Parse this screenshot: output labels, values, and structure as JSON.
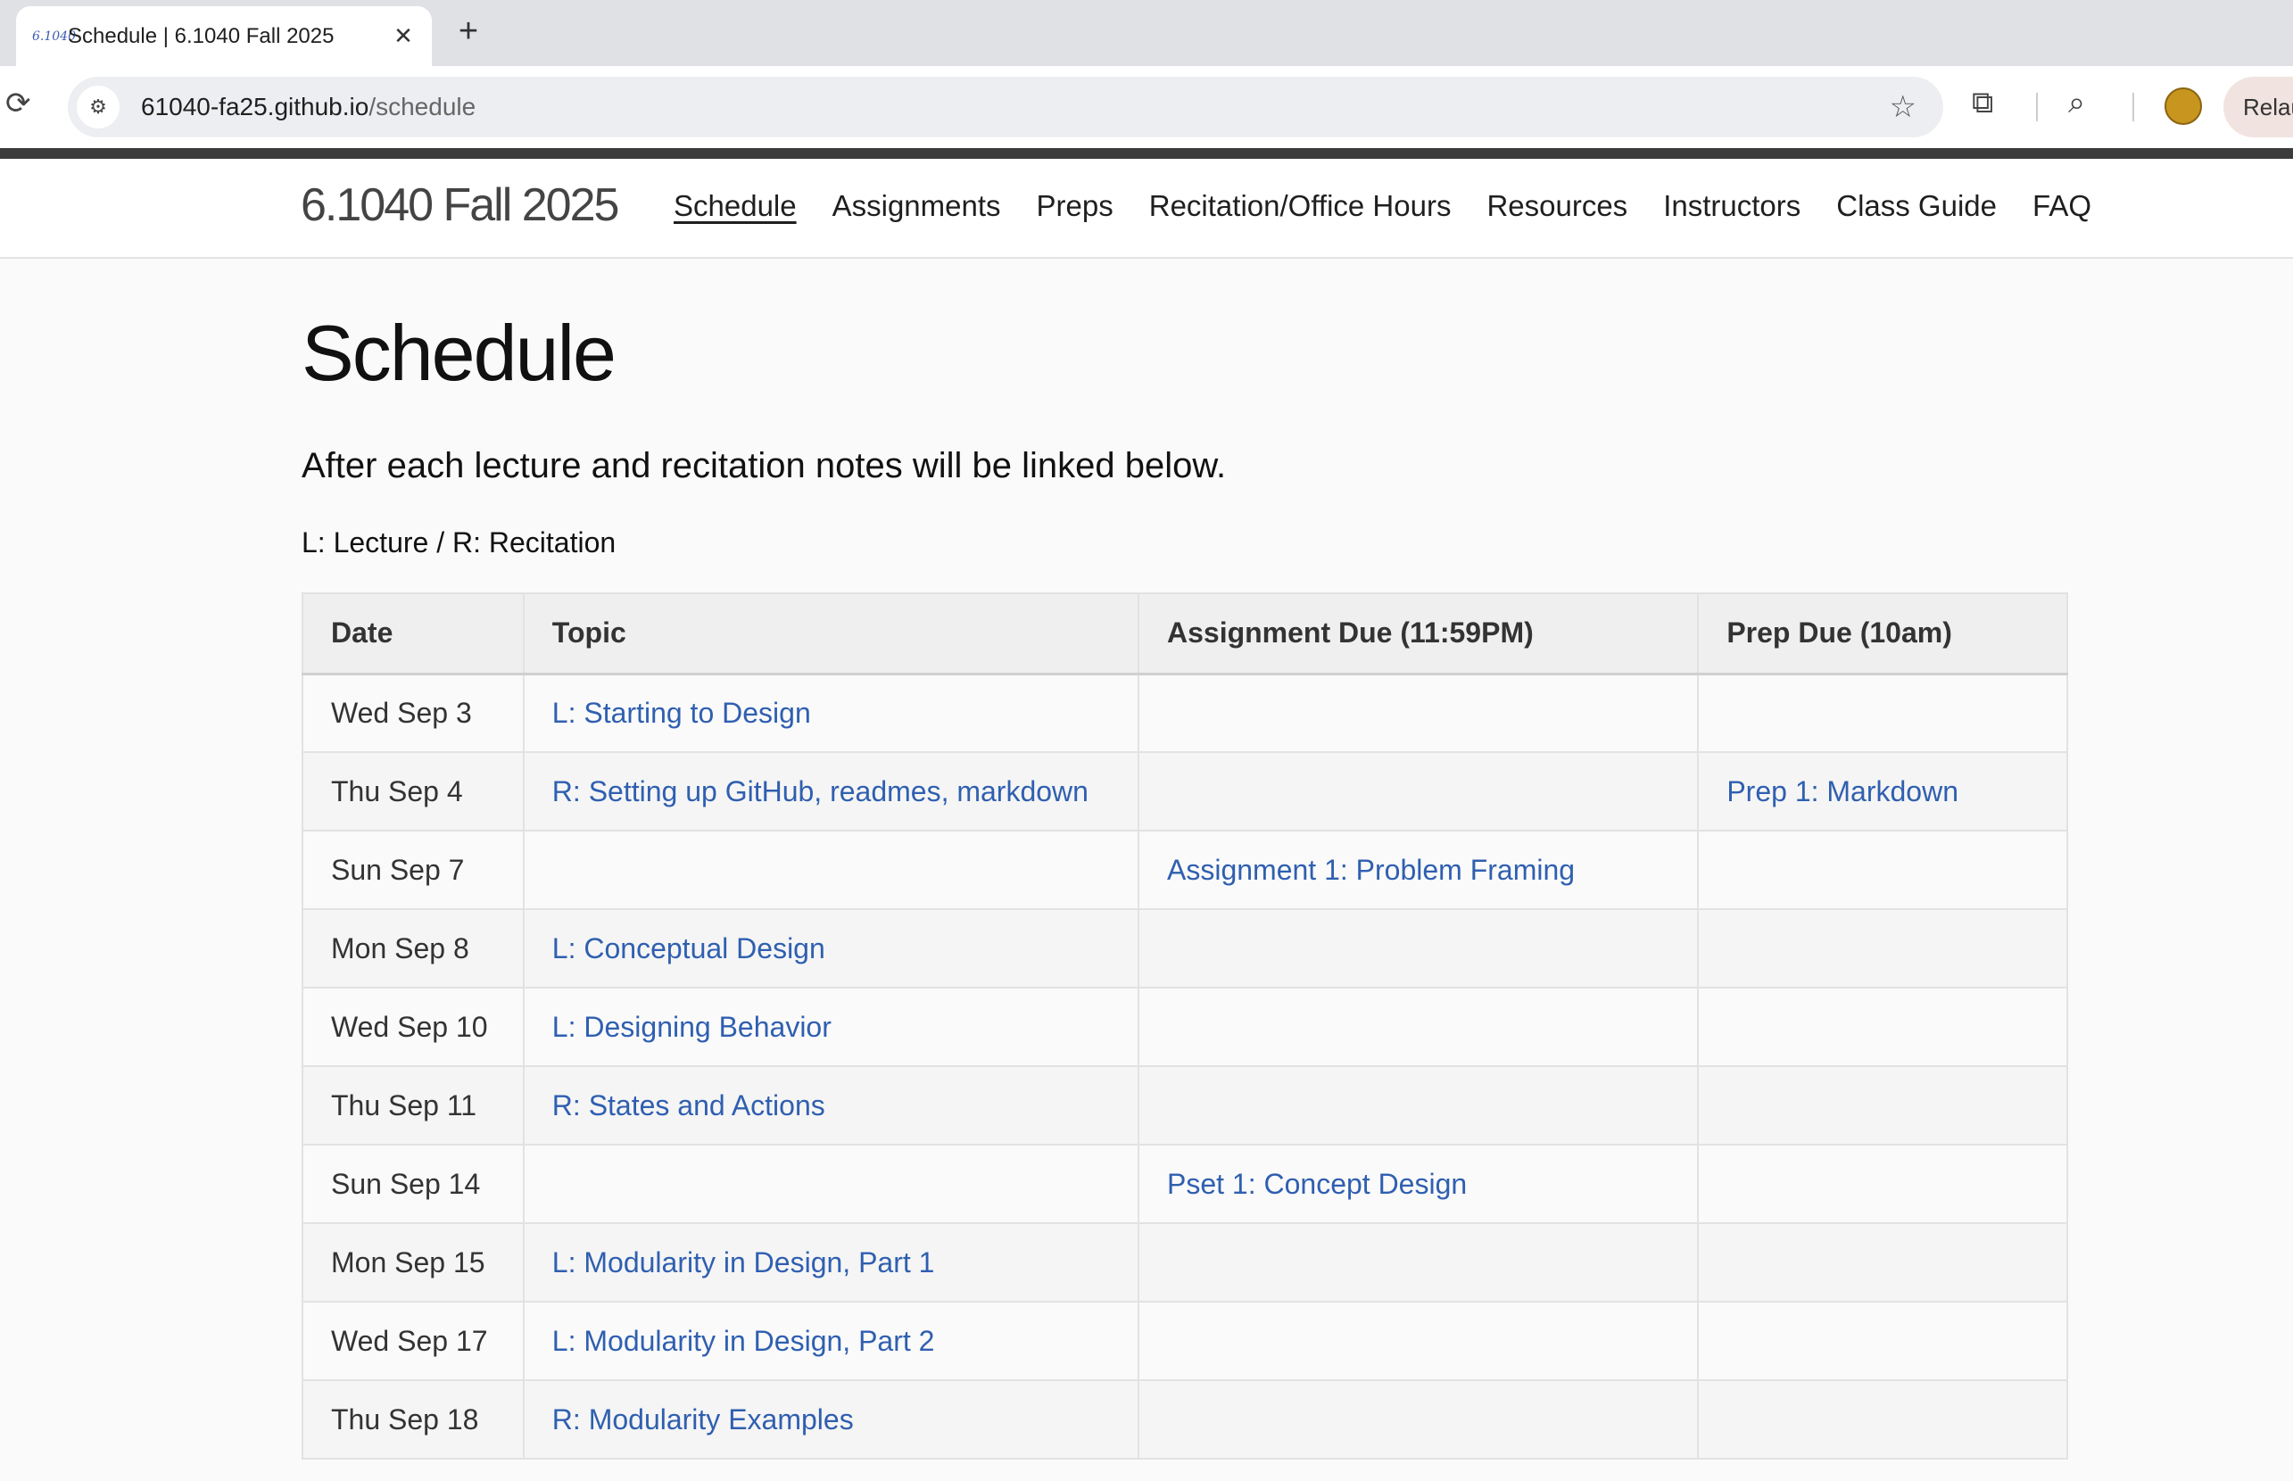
{
  "browser": {
    "tab_favicon": "6.1040",
    "tab_title": "Schedule | 6.1040 Fall 2025",
    "tab_close": "✕",
    "new_tab": "+",
    "url_host": "61040-fa25.github.io",
    "url_path": "/schedule",
    "relaunch_label": "Relau"
  },
  "site": {
    "brand": "6.1040 Fall 2025",
    "nav": [
      {
        "label": "Schedule"
      },
      {
        "label": "Assignments"
      },
      {
        "label": "Preps"
      },
      {
        "label": "Recitation/Office Hours"
      },
      {
        "label": "Resources"
      },
      {
        "label": "Instructors"
      },
      {
        "label": "Class Guide"
      },
      {
        "label": "FAQ"
      }
    ]
  },
  "page": {
    "title": "Schedule",
    "intro": "After each lecture and recitation notes will be linked below.",
    "legend": "L: Lecture / R: Recitation"
  },
  "table": {
    "headers": [
      "Date",
      "Topic",
      "Assignment Due (11:59PM)",
      "Prep Due (10am)"
    ],
    "rows": [
      {
        "date": "Wed Sep 3",
        "topic": "L: Starting to Design",
        "assignment": "",
        "prep": ""
      },
      {
        "date": "Thu Sep 4",
        "topic": "R: Setting up GitHub, readmes, markdown",
        "assignment": "",
        "prep": "Prep 1: Markdown"
      },
      {
        "date": "Sun Sep 7",
        "topic": "",
        "assignment": "Assignment 1: Problem Framing",
        "prep": ""
      },
      {
        "date": "Mon Sep 8",
        "topic": "L: Conceptual Design",
        "assignment": "",
        "prep": ""
      },
      {
        "date": "Wed Sep 10",
        "topic": "L: Designing Behavior",
        "assignment": "",
        "prep": ""
      },
      {
        "date": "Thu Sep 11",
        "topic": "R: States and Actions",
        "assignment": "",
        "prep": ""
      },
      {
        "date": "Sun Sep 14",
        "topic": "",
        "assignment": "Pset 1: Concept Design",
        "prep": ""
      },
      {
        "date": "Mon Sep 15",
        "topic": "L: Modularity in Design, Part 1",
        "assignment": "",
        "prep": ""
      },
      {
        "date": "Wed Sep 17",
        "topic": "L: Modularity in Design, Part 2",
        "assignment": "",
        "prep": ""
      },
      {
        "date": "Thu Sep 18",
        "topic": "R: Modularity Examples",
        "assignment": "",
        "prep": ""
      }
    ]
  },
  "colors": {
    "link": "#2f5fb0",
    "header_bg": "#efefef",
    "accent_bar": "#3c3c3c"
  },
  "icons": [
    "reload-icon",
    "site-info-icon",
    "star-icon",
    "extensions-icon",
    "tab-search-icon",
    "avatar-icon",
    "close-icon",
    "plus-icon"
  ]
}
